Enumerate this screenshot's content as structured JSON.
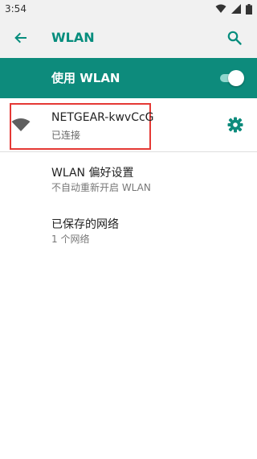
{
  "status": {
    "time": "3:54",
    "icons": [
      "wifi-icon",
      "signal-icon",
      "battery-icon"
    ]
  },
  "header": {
    "title": "WLAN",
    "back_icon": "back-arrow-icon",
    "search_icon": "search-icon",
    "title_color": "#068d7d"
  },
  "wlan_toggle": {
    "label": "使用 WLAN",
    "on": true,
    "bar_color": "#0d8b7c"
  },
  "networks": [
    {
      "name": "NETGEAR-kwvCcG",
      "status": "已连接",
      "icon": "wifi-signal-icon",
      "settings_icon": "gear-icon"
    }
  ],
  "preferences": {
    "title": "WLAN 偏好设置",
    "subtitle": "不自动重新开启 WLAN"
  },
  "saved_networks": {
    "title": "已保存的网络",
    "subtitle": "1 个网络"
  }
}
